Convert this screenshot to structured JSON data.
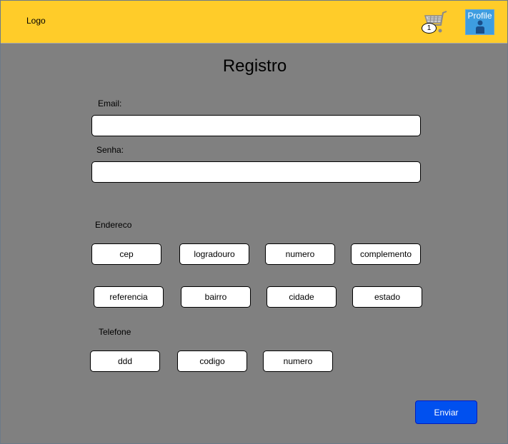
{
  "header": {
    "logo": "Logo",
    "cart_count": "1",
    "profile_label": "Profile"
  },
  "form": {
    "title": "Registro",
    "email_label": "Email:",
    "senha_label": "Senha:",
    "endereco_label": "Endereco",
    "endereco_fields": [
      "cep",
      "logradouro",
      "numero",
      "complemento",
      "referencia",
      "bairro",
      "cidade",
      "estado"
    ],
    "telefone_label": "Telefone",
    "telefone_fields": [
      "ddd",
      "codigo",
      "numero"
    ],
    "submit_label": "Enviar"
  },
  "colors": {
    "header_bg": "#ffcc29",
    "page_bg": "#808080",
    "button_bg": "#0050ef",
    "profile_bg": "#3d9de0"
  },
  "icons": {
    "cart": "cart-icon",
    "profile": "user-icon"
  }
}
